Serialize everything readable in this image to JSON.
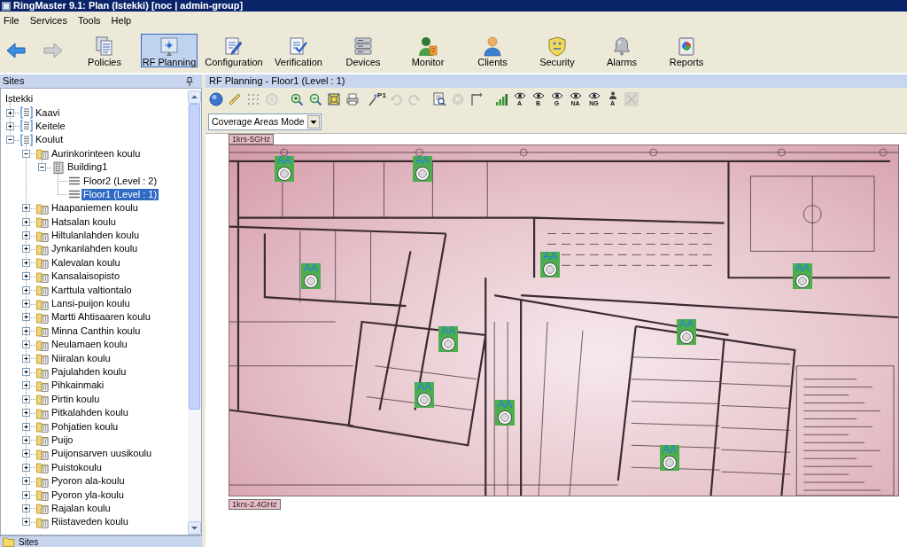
{
  "window": {
    "title": "RingMaster 9.1: Plan (Istekki) [noc | admin-group]"
  },
  "menu": [
    "File",
    "Services",
    "Tools",
    "Help"
  ],
  "navigation": [
    {
      "kind": "back",
      "disabled": false
    },
    {
      "kind": "forward",
      "disabled": true
    }
  ],
  "toolbar": [
    {
      "label": "Policies",
      "selected": false
    },
    {
      "label": "RF Planning",
      "selected": true
    },
    {
      "label": "Configuration",
      "selected": false
    },
    {
      "label": "Verification",
      "selected": false
    },
    {
      "label": "Devices",
      "selected": false
    },
    {
      "label": "Monitor",
      "selected": false
    },
    {
      "label": "Clients",
      "selected": false
    },
    {
      "label": "Security",
      "selected": false
    },
    {
      "label": "Alarms",
      "selected": false
    },
    {
      "label": "Reports",
      "selected": false
    }
  ],
  "sites_panel": {
    "title": "Sites",
    "tree": [
      {
        "label": "Istekki",
        "kind": "root",
        "selected": false,
        "children": [
          {
            "label": "Kaavi",
            "kind": "site",
            "expanded": false,
            "selected": false
          },
          {
            "label": "Keitele",
            "kind": "site",
            "expanded": false,
            "selected": false
          },
          {
            "label": "Koulut",
            "kind": "site",
            "expanded": true,
            "selected": false,
            "children": [
              {
                "label": "Aurinkorinteen koulu",
                "kind": "school",
                "expanded": true,
                "selected": false,
                "children": [
                  {
                    "label": "Building1",
                    "kind": "building",
                    "expanded": true,
                    "selected": false,
                    "children": [
                      {
                        "label": "Floor2 (Level : 2)",
                        "kind": "floor",
                        "selected": false
                      },
                      {
                        "label": "Floor1 (Level : 1)",
                        "kind": "floor",
                        "selected": true
                      }
                    ]
                  }
                ]
              },
              {
                "label": "Haapaniemen koulu",
                "kind": "school",
                "expanded": false,
                "selected": false
              },
              {
                "label": "Hatsalan koulu",
                "kind": "school",
                "expanded": false,
                "selected": false
              },
              {
                "label": "Hiltulanlahden koulu",
                "kind": "school",
                "expanded": false,
                "selected": false
              },
              {
                "label": "Jynkanlahden koulu",
                "kind": "school",
                "expanded": false,
                "selected": false
              },
              {
                "label": "Kalevalan koulu",
                "kind": "school",
                "expanded": false,
                "selected": false
              },
              {
                "label": "Kansalaisopisto",
                "kind": "school",
                "expanded": false,
                "selected": false
              },
              {
                "label": "Karttula valtiontalo",
                "kind": "school",
                "expanded": false,
                "selected": false
              },
              {
                "label": "Lansi-puijon koulu",
                "kind": "school",
                "expanded": false,
                "selected": false
              },
              {
                "label": "Martti Ahtisaaren koulu",
                "kind": "school",
                "expanded": false,
                "selected": false
              },
              {
                "label": "Minna Canthin koulu",
                "kind": "school",
                "expanded": false,
                "selected": false
              },
              {
                "label": "Neulamaen koulu",
                "kind": "school",
                "expanded": false,
                "selected": false
              },
              {
                "label": "Niiralan koulu",
                "kind": "school",
                "expanded": false,
                "selected": false
              },
              {
                "label": "Pajulahden koulu",
                "kind": "school",
                "expanded": false,
                "selected": false
              },
              {
                "label": "Pihkainmaki",
                "kind": "school",
                "expanded": false,
                "selected": false
              },
              {
                "label": "Pirtin koulu",
                "kind": "school",
                "expanded": false,
                "selected": false
              },
              {
                "label": "Pitkalahden koulu",
                "kind": "school",
                "expanded": false,
                "selected": false
              },
              {
                "label": "Pohjatien koulu",
                "kind": "school",
                "expanded": false,
                "selected": false
              },
              {
                "label": "Puijo",
                "kind": "school",
                "expanded": false,
                "selected": false
              },
              {
                "label": "Puijonsarven uusikoulu",
                "kind": "school",
                "expanded": false,
                "selected": false
              },
              {
                "label": "Puistokoulu",
                "kind": "school",
                "expanded": false,
                "selected": false
              },
              {
                "label": "Pyoron ala-koulu",
                "kind": "school",
                "expanded": false,
                "selected": false
              },
              {
                "label": "Pyoron yla-koulu",
                "kind": "school",
                "expanded": false,
                "selected": false
              },
              {
                "label": "Rajalan koulu",
                "kind": "school",
                "expanded": false,
                "selected": false
              },
              {
                "label": "Riistaveden koulu",
                "kind": "school",
                "expanded": false,
                "selected": false
              }
            ]
          }
        ]
      }
    ],
    "bottom_tab": "Sites"
  },
  "planning_panel": {
    "title": "RF Planning - Floor1 (Level : 1)",
    "tool_groups": [
      [
        {
          "disabled": false
        },
        {
          "disabled": false
        },
        {
          "disabled": false
        },
        {
          "disabled": true
        }
      ],
      [
        {
          "disabled": false
        },
        {
          "disabled": false
        },
        {
          "disabled": false
        },
        {
          "disabled": false
        }
      ],
      [
        {
          "label": "P1",
          "disabled": false
        },
        {
          "disabled": true
        },
        {
          "disabled": true
        }
      ],
      [
        {
          "disabled": false
        },
        {
          "disabled": true
        },
        {
          "disabled": false
        }
      ],
      [
        {
          "disabled": false
        },
        {
          "label": "A",
          "disabled": false
        },
        {
          "label": "B",
          "disabled": false
        },
        {
          "label": "G",
          "disabled": false
        },
        {
          "label": "NA",
          "disabled": false
        },
        {
          "label": "NG",
          "disabled": false
        },
        {
          "label": "A",
          "disabled": false
        },
        {
          "disabled": true
        }
      ]
    ],
    "mode_dropdown": {
      "value": "Coverage Areas Mode"
    },
    "floor_labels": [
      "1krs-5GHz",
      "1krs-2.4GHz"
    ],
    "access_points": [
      {
        "label": "AA"
      },
      {
        "label": "AA"
      },
      {
        "label": "AA"
      },
      {
        "label": "AA"
      },
      {
        "label": "AA"
      },
      {
        "label": "AA"
      },
      {
        "label": "AA"
      },
      {
        "label": "AA"
      },
      {
        "label": "AA"
      },
      {
        "label": "AA"
      }
    ]
  }
}
